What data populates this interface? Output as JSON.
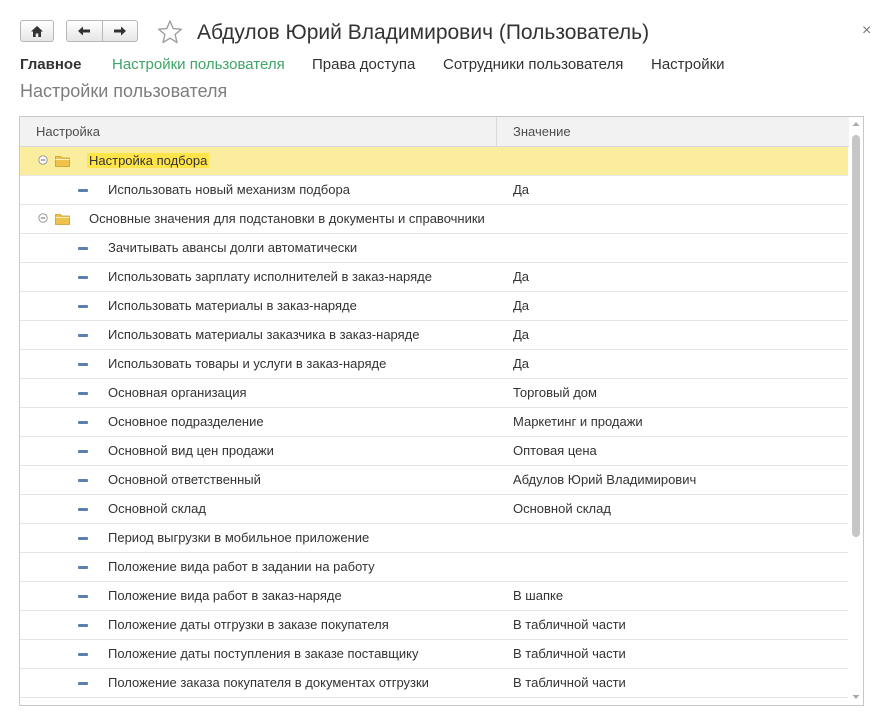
{
  "window": {
    "title": "Абдулов Юрий Владимирович (Пользователь)",
    "close_glyph": "×",
    "icons": {
      "home": "home-icon",
      "back": "arrow-left-icon",
      "forward": "arrow-right-icon",
      "favorite": "star-icon"
    }
  },
  "tabs": [
    {
      "label": "Главное",
      "state": "bold"
    },
    {
      "label": "Настройки пользователя",
      "state": "active"
    },
    {
      "label": "Права доступа",
      "state": "normal"
    },
    {
      "label": "Сотрудники пользователя",
      "state": "normal"
    },
    {
      "label": "Настройки",
      "state": "normal"
    }
  ],
  "section_title": "Настройки пользователя",
  "grid": {
    "columns": {
      "setting": "Настройка",
      "value": "Значение"
    },
    "rows": [
      {
        "type": "group",
        "name": "Настройка подбора",
        "value": "",
        "selected": true
      },
      {
        "type": "item",
        "name": "Использовать новый механизм подбора",
        "value": "Да"
      },
      {
        "type": "group",
        "name": "Основные значения для подстановки в документы и справочники",
        "value": ""
      },
      {
        "type": "item",
        "name": "Зачитывать авансы долги автоматически",
        "value": ""
      },
      {
        "type": "item",
        "name": "Использовать зарплату исполнителей в заказ-наряде",
        "value": "Да"
      },
      {
        "type": "item",
        "name": "Использовать материалы в заказ-наряде",
        "value": "Да"
      },
      {
        "type": "item",
        "name": "Использовать материалы заказчика в заказ-наряде",
        "value": "Да"
      },
      {
        "type": "item",
        "name": "Использовать товары и услуги в заказ-наряде",
        "value": "Да"
      },
      {
        "type": "item",
        "name": "Основная организация",
        "value": "Торговый дом"
      },
      {
        "type": "item",
        "name": "Основное подразделение",
        "value": "Маркетинг и продажи"
      },
      {
        "type": "item",
        "name": "Основной вид цен продажи",
        "value": "Оптовая цена"
      },
      {
        "type": "item",
        "name": "Основной ответственный",
        "value": "Абдулов Юрий Владимирович"
      },
      {
        "type": "item",
        "name": "Основной склад",
        "value": "Основной склад"
      },
      {
        "type": "item",
        "name": "Период выгрузки в мобильное приложение",
        "value": ""
      },
      {
        "type": "item",
        "name": "Положение вида работ в задании на работу",
        "value": ""
      },
      {
        "type": "item",
        "name": "Положение вида работ в заказ-наряде",
        "value": "В шапке"
      },
      {
        "type": "item",
        "name": "Положение даты отгрузки в заказе покупателя",
        "value": "В табличной части"
      },
      {
        "type": "item",
        "name": "Положение даты поступления в заказе поставщику",
        "value": "В табличной части"
      },
      {
        "type": "item",
        "name": "Положение заказа покупателя в документах отгрузки",
        "value": "В табличной части"
      }
    ]
  },
  "colors": {
    "active_tab": "#3fa568",
    "selected_row": "#fbed9e",
    "selected_text_highlight": "#ffe44a",
    "folder": "#f0c24b"
  }
}
